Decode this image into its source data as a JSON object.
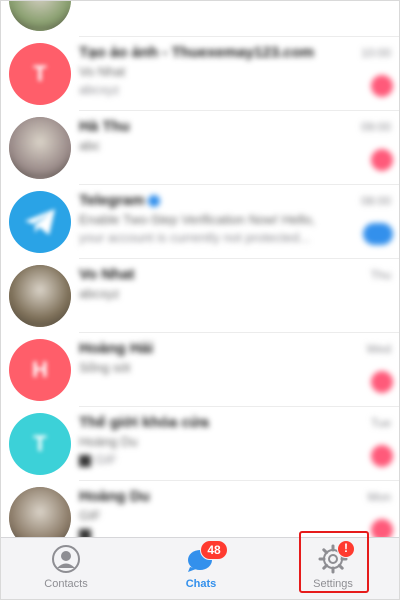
{
  "chat_list": [
    {
      "title": "",
      "line2": "",
      "line3": "",
      "time": "",
      "avatar_initial": "",
      "avatar_color": "#8aa070",
      "avatar_kind": "photo",
      "unread": false
    },
    {
      "title": "Tạo ảo ảnh - Thuexemay123.com",
      "line2": "Vo Nhat",
      "line3": "abcxyz",
      "time": "10:00",
      "avatar_initial": "T",
      "avatar_color": "#ff5e6a",
      "avatar_kind": "initial",
      "unread": true
    },
    {
      "title": "Hà Thu",
      "line2": "abc",
      "line3": "",
      "time": "09:00",
      "avatar_initial": "",
      "avatar_color": "#9b8c8a",
      "avatar_kind": "photo",
      "unread": true
    },
    {
      "title": "Telegram",
      "line2": "Enable Two-Step Verification Now! Hello,",
      "line3": "your account is currently not protected...",
      "time": "08:00",
      "avatar_initial": "",
      "avatar_color": "#2aa3e6",
      "avatar_kind": "telegram",
      "unread": true,
      "unread_blue": true,
      "verified": true
    },
    {
      "title": "Vo Nhat",
      "line2": "abcxyz",
      "line3": "",
      "time": "Thu",
      "avatar_initial": "",
      "avatar_color": "#7d6f58",
      "avatar_kind": "photo",
      "unread": false
    },
    {
      "title": "Hoàng Hải",
      "line2": "Sống sót",
      "line3": "",
      "time": "Wed",
      "avatar_initial": "H",
      "avatar_color": "#ff5e6a",
      "avatar_kind": "initial",
      "unread": true
    },
    {
      "title": "Thế giới khóa cửa",
      "line2": "Hoàng Du",
      "line3": "GIF",
      "time": "Tue",
      "avatar_initial": "T",
      "avatar_color": "#3cd1d8",
      "avatar_kind": "initial",
      "unread": true,
      "thumb": true
    },
    {
      "title": "Hoàng Du",
      "line2": "GIF",
      "line3": "",
      "time": "Mon",
      "avatar_initial": "",
      "avatar_color": "#8d7d6a",
      "avatar_kind": "photo",
      "unread": true,
      "thumb": true
    }
  ],
  "tab_bar": {
    "contacts_label": "Contacts",
    "chats_label": "Chats",
    "chats_badge": "48",
    "settings_label": "Settings",
    "settings_badge": "!",
    "active_color": "#3390ec",
    "inactive_color": "#8e8e93"
  },
  "colors": {
    "highlight": "#e61b1b",
    "badge": "#ff3b30"
  }
}
